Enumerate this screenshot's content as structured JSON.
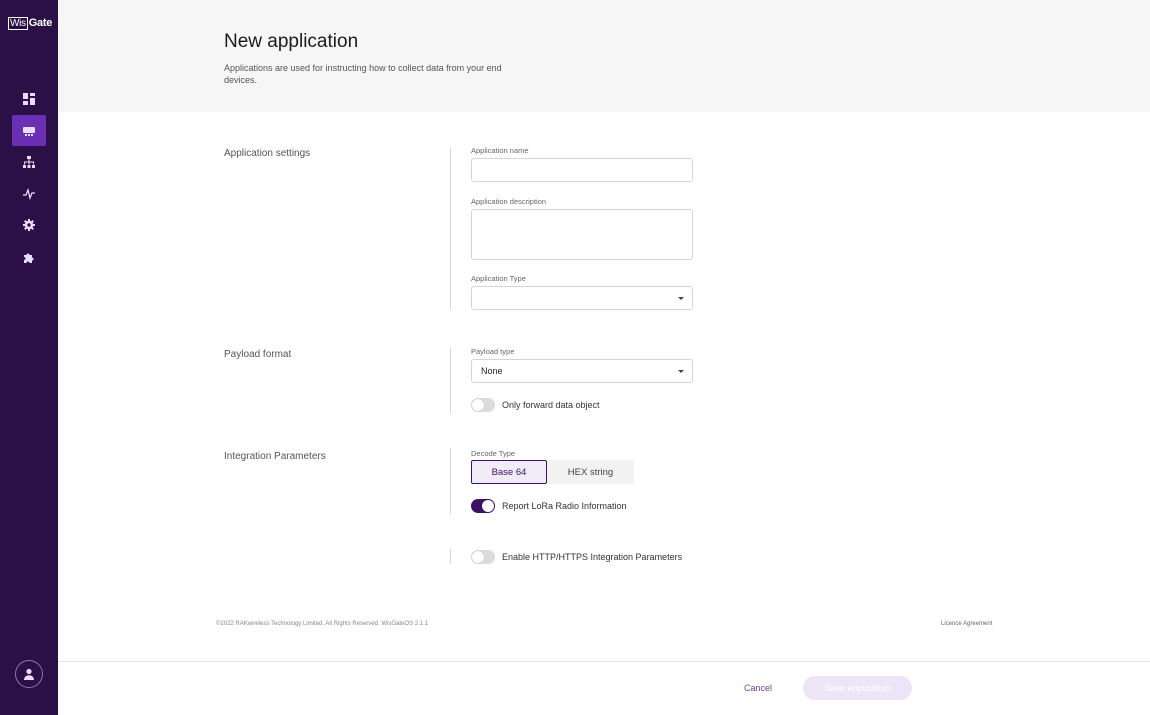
{
  "brand": {
    "logo_prefix": "Wis",
    "logo_suffix": "Gate"
  },
  "sidebar": {
    "items": [
      {
        "id": "dashboard",
        "icon": "dashboard-icon"
      },
      {
        "id": "applications",
        "icon": "applications-icon",
        "active": true
      },
      {
        "id": "network",
        "icon": "network-icon"
      },
      {
        "id": "activity",
        "icon": "activity-icon"
      },
      {
        "id": "settings",
        "icon": "gear-icon"
      },
      {
        "id": "extensions",
        "icon": "puzzle-icon"
      }
    ],
    "user_icon": "user-icon"
  },
  "header": {
    "title": "New application",
    "description": "Applications are used for instructing how to collect data from your end devices."
  },
  "application_settings": {
    "label": "Application settings",
    "name_label": "Application name",
    "name_value": "",
    "description_label": "Application description",
    "description_value": "",
    "type_label": "Application Type",
    "type_value": ""
  },
  "payload_format": {
    "label": "Payload format",
    "type_label": "Payload type",
    "type_value": "None",
    "forward_label": "Only forward data object",
    "forward_on": false
  },
  "integration": {
    "label": "Integration Parameters",
    "decode_label": "Decode Type",
    "decode_options": [
      "Base 64",
      "HEX string"
    ],
    "decode_selected": "Base 64",
    "report_label": "Report LoRa Radio Information",
    "report_on": true,
    "http_label": "Enable HTTP/HTTPS Integration Parameters",
    "http_on": false
  },
  "footer": {
    "copyright": "©2022 RAKwireless Technology Limited. All Rights Reserved. WisGateOS 2.1.1",
    "licence": "Licence Agreement",
    "cancel": "Cancel",
    "save": "Save application"
  },
  "colors": {
    "sidebar": "#2a1046",
    "accent": "#6b2fb5",
    "toggle_on": "#3a1462"
  }
}
